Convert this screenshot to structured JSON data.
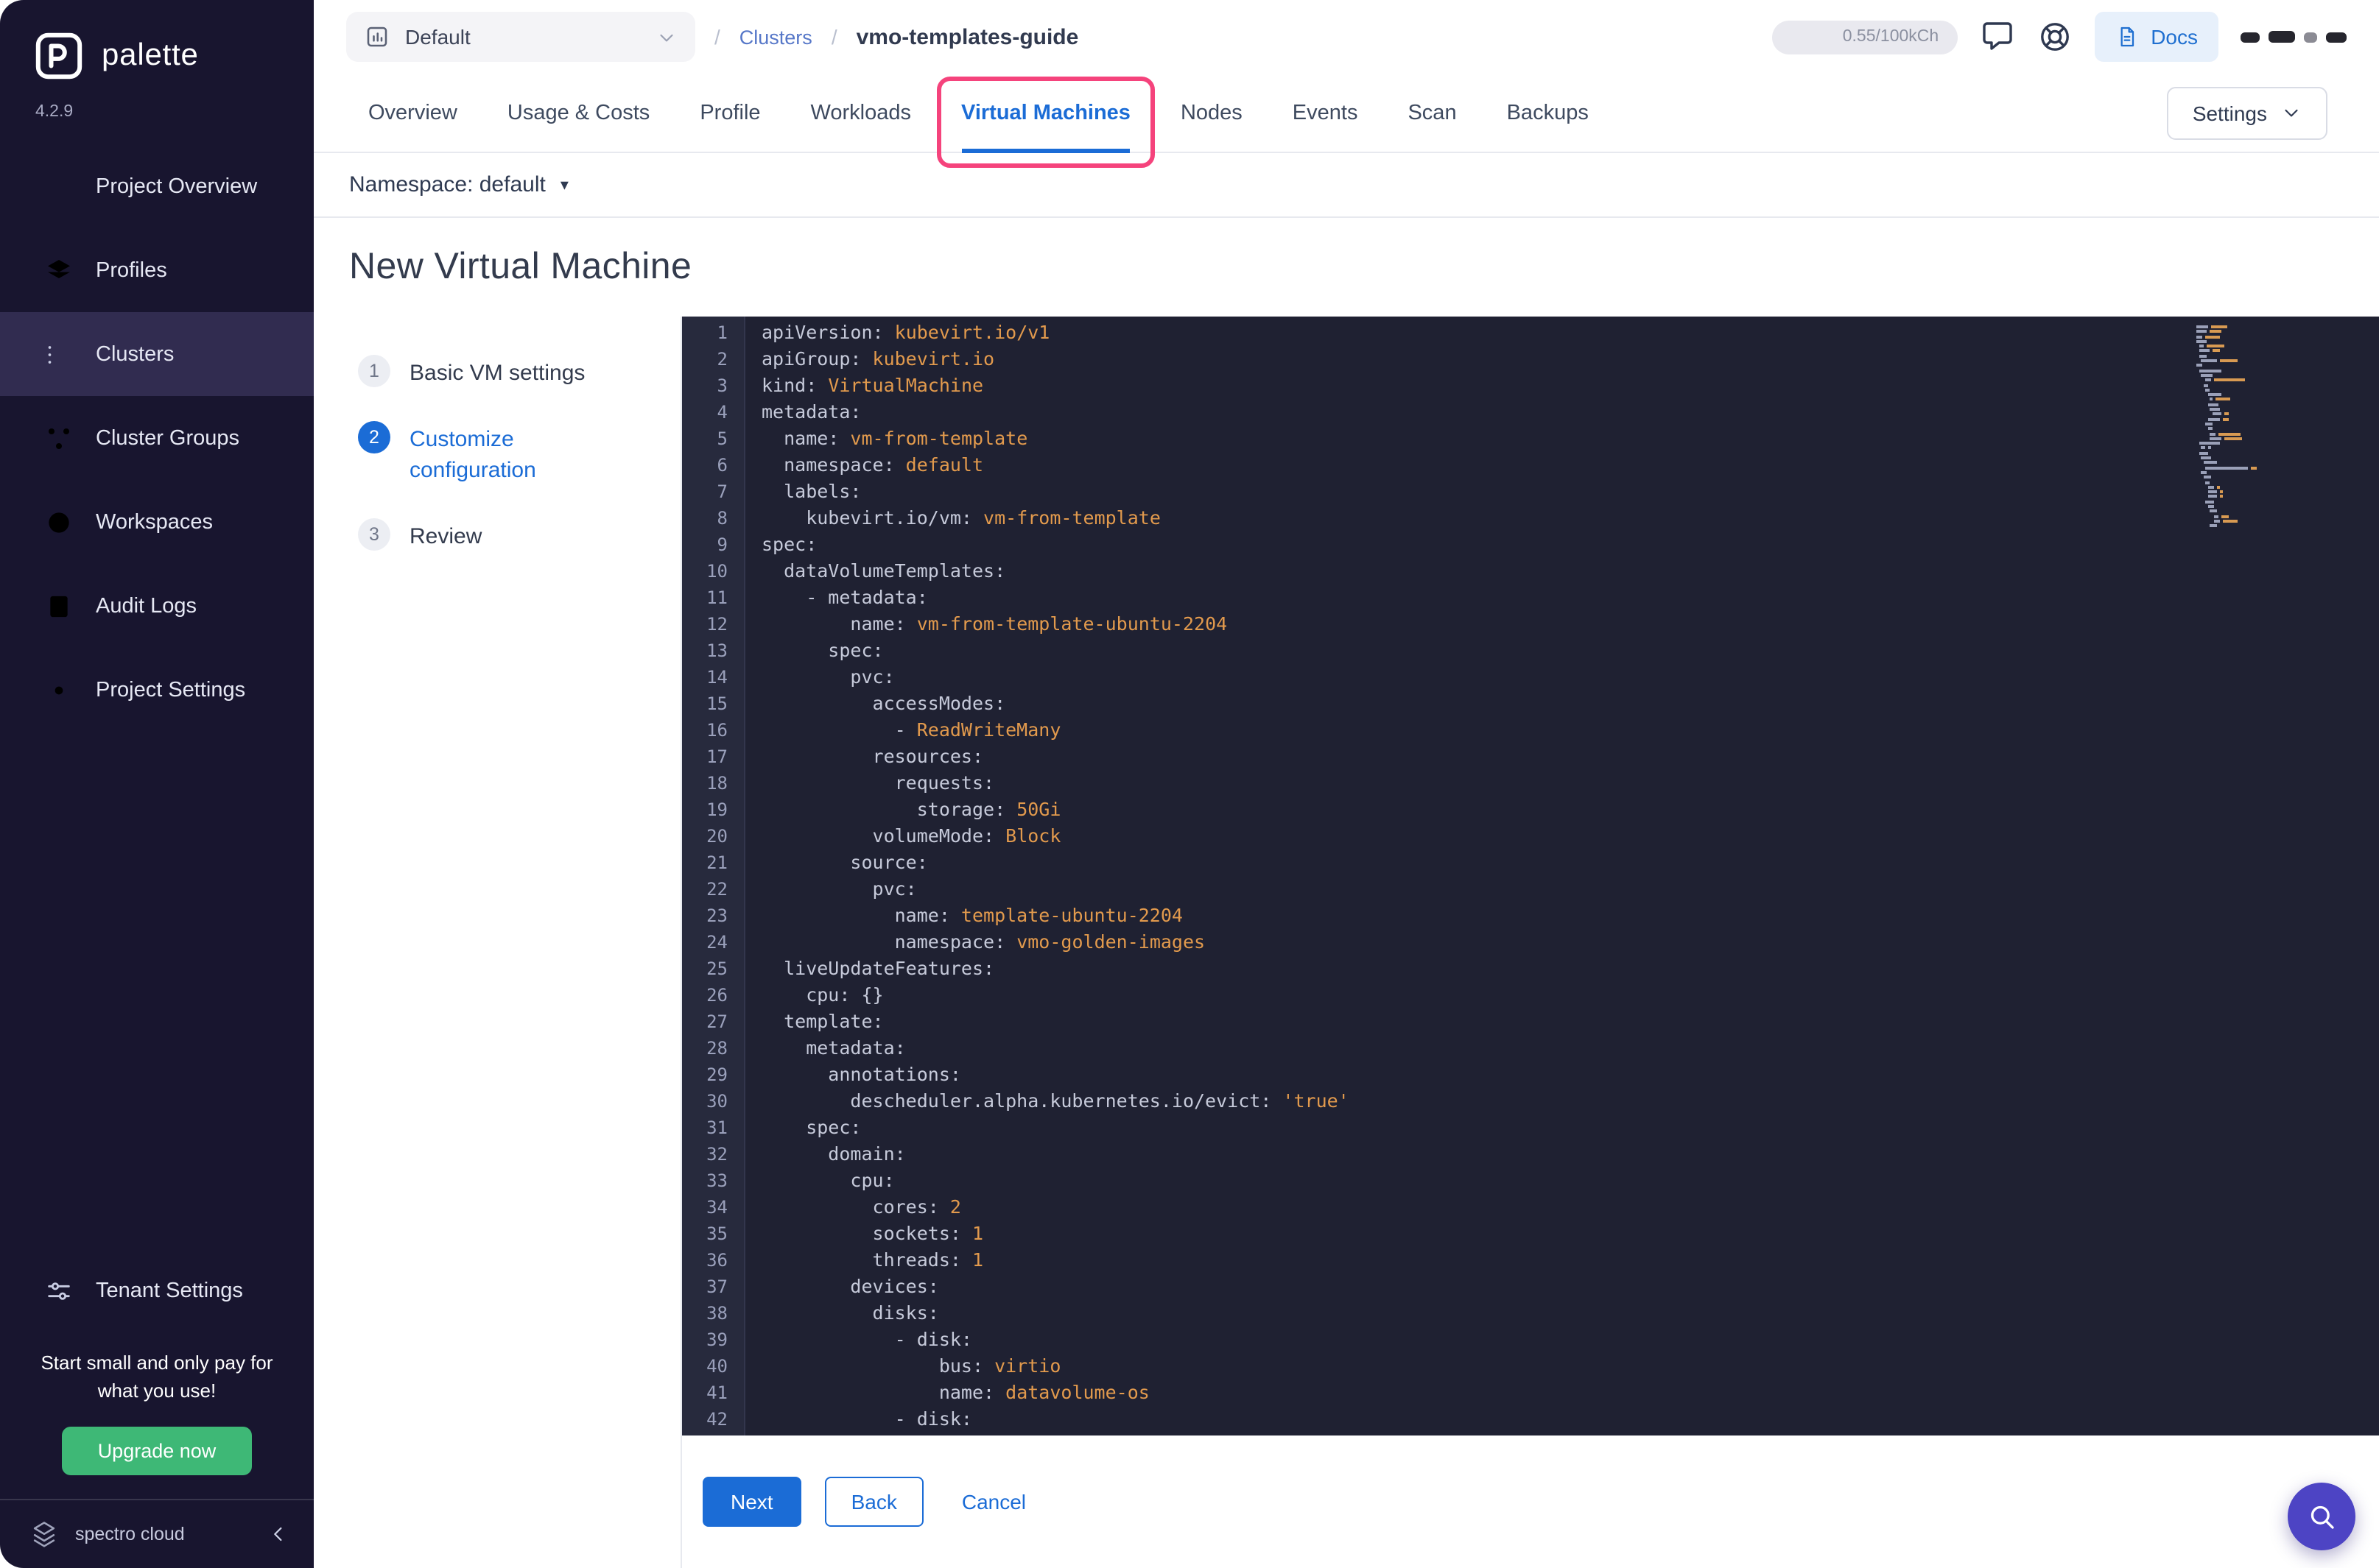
{
  "colors": {
    "accent_blue": "#1b6cd6",
    "annotation_pink": "#f5437c",
    "upgrade_green": "#3eb876",
    "yaml_value_orange": "#e29a4d",
    "sidebar_bg": "#18152f",
    "editor_bg": "#1f2132"
  },
  "sidebar": {
    "logo_text": "palette",
    "version": "4.2.9",
    "items": [
      {
        "id": "project-overview",
        "label": "Project Overview",
        "icon": "chart-icon",
        "active": false
      },
      {
        "id": "profiles",
        "label": "Profiles",
        "icon": "layers-icon",
        "active": false
      },
      {
        "id": "clusters",
        "label": "Clusters",
        "icon": "clusters-icon",
        "active": true
      },
      {
        "id": "cluster-groups",
        "label": "Cluster Groups",
        "icon": "share-icon",
        "active": false
      },
      {
        "id": "workspaces",
        "label": "Workspaces",
        "icon": "workspaces-icon",
        "active": false
      },
      {
        "id": "audit-logs",
        "label": "Audit Logs",
        "icon": "audit-icon",
        "active": false
      },
      {
        "id": "project-settings",
        "label": "Project Settings",
        "icon": "gear-icon",
        "active": false
      }
    ],
    "tenant_label": "Tenant Settings",
    "promo_text": "Start small and only pay for what you use!",
    "upgrade_label": "Upgrade now",
    "brand": "spectro cloud"
  },
  "header": {
    "project_selector": "Default",
    "separator": "/",
    "breadcrumb_root": "Clusters",
    "breadcrumb_current": "vmo-templates-guide",
    "usage": "0.55/100kCh",
    "docs_label": "Docs"
  },
  "tabs": {
    "items": [
      "Overview",
      "Usage & Costs",
      "Profile",
      "Workloads",
      "Virtual Machines",
      "Nodes",
      "Events",
      "Scan",
      "Backups"
    ],
    "active": "Virtual Machines",
    "settings_label": "Settings"
  },
  "toolbar": {
    "namespace_label": "Namespace: default",
    "caret": "▾"
  },
  "page": {
    "title": "New Virtual Machine"
  },
  "stepper": [
    {
      "number": "1",
      "label": "Basic VM settings",
      "active": false
    },
    {
      "number": "2",
      "label": "Customize configuration",
      "active": true
    },
    {
      "number": "3",
      "label": "Review",
      "active": false
    }
  ],
  "editor": {
    "language": "yaml",
    "lines": [
      [
        [
          "apiVersion:",
          "k"
        ],
        [
          " kubevirt.io/v1",
          "v"
        ]
      ],
      [
        [
          "apiGroup:",
          "k"
        ],
        [
          " kubevirt.io",
          "v"
        ]
      ],
      [
        [
          "kind:",
          "k"
        ],
        [
          " VirtualMachine",
          "v"
        ]
      ],
      [
        [
          "metadata:",
          "k"
        ]
      ],
      [
        [
          "  name:",
          "k"
        ],
        [
          " vm-from-template",
          "v"
        ]
      ],
      [
        [
          "  namespace:",
          "k"
        ],
        [
          " default",
          "v"
        ]
      ],
      [
        [
          "  labels:",
          "k"
        ]
      ],
      [
        [
          "    kubevirt.io/vm:",
          "k"
        ],
        [
          " vm-from-template",
          "v"
        ]
      ],
      [
        [
          "spec:",
          "k"
        ]
      ],
      [
        [
          "  dataVolumeTemplates:",
          "k"
        ]
      ],
      [
        [
          "    - metadata:",
          "k"
        ]
      ],
      [
        [
          "        name:",
          "k"
        ],
        [
          " vm-from-template-ubuntu-2204",
          "v"
        ]
      ],
      [
        [
          "      spec:",
          "k"
        ]
      ],
      [
        [
          "        pvc:",
          "k"
        ]
      ],
      [
        [
          "          accessModes:",
          "k"
        ]
      ],
      [
        [
          "            - ",
          "k"
        ],
        [
          "ReadWriteMany",
          "v"
        ]
      ],
      [
        [
          "          resources:",
          "k"
        ]
      ],
      [
        [
          "            requests:",
          "k"
        ]
      ],
      [
        [
          "              storage:",
          "k"
        ],
        [
          " 50Gi",
          "v"
        ]
      ],
      [
        [
          "          volumeMode:",
          "k"
        ],
        [
          " Block",
          "v"
        ]
      ],
      [
        [
          "        source:",
          "k"
        ]
      ],
      [
        [
          "          pvc:",
          "k"
        ]
      ],
      [
        [
          "            name:",
          "k"
        ],
        [
          " template-ubuntu-2204",
          "v"
        ]
      ],
      [
        [
          "            namespace:",
          "k"
        ],
        [
          " vmo-golden-images",
          "v"
        ]
      ],
      [
        [
          "  liveUpdateFeatures:",
          "k"
        ]
      ],
      [
        [
          "    cpu:",
          "k"
        ],
        [
          " {}",
          "k"
        ]
      ],
      [
        [
          "  template:",
          "k"
        ]
      ],
      [
        [
          "    metadata:",
          "k"
        ]
      ],
      [
        [
          "      annotations:",
          "k"
        ]
      ],
      [
        [
          "        descheduler.alpha.kubernetes.io/evict:",
          "k"
        ],
        [
          " 'true'",
          "v"
        ]
      ],
      [
        [
          "    spec:",
          "k"
        ]
      ],
      [
        [
          "      domain:",
          "k"
        ]
      ],
      [
        [
          "        cpu:",
          "k"
        ]
      ],
      [
        [
          "          cores:",
          "k"
        ],
        [
          " 2",
          "v"
        ]
      ],
      [
        [
          "          sockets:",
          "k"
        ],
        [
          " 1",
          "v"
        ]
      ],
      [
        [
          "          threads:",
          "k"
        ],
        [
          " 1",
          "v"
        ]
      ],
      [
        [
          "        devices:",
          "k"
        ]
      ],
      [
        [
          "          disks:",
          "k"
        ]
      ],
      [
        [
          "            - disk:",
          "k"
        ]
      ],
      [
        [
          "                bus:",
          "k"
        ],
        [
          " virtio",
          "v"
        ]
      ],
      [
        [
          "                name:",
          "k"
        ],
        [
          " datavolume-os",
          "v"
        ]
      ],
      [
        [
          "            - disk:",
          "k"
        ]
      ]
    ]
  },
  "footer": {
    "next": "Next",
    "back": "Back",
    "cancel": "Cancel"
  }
}
